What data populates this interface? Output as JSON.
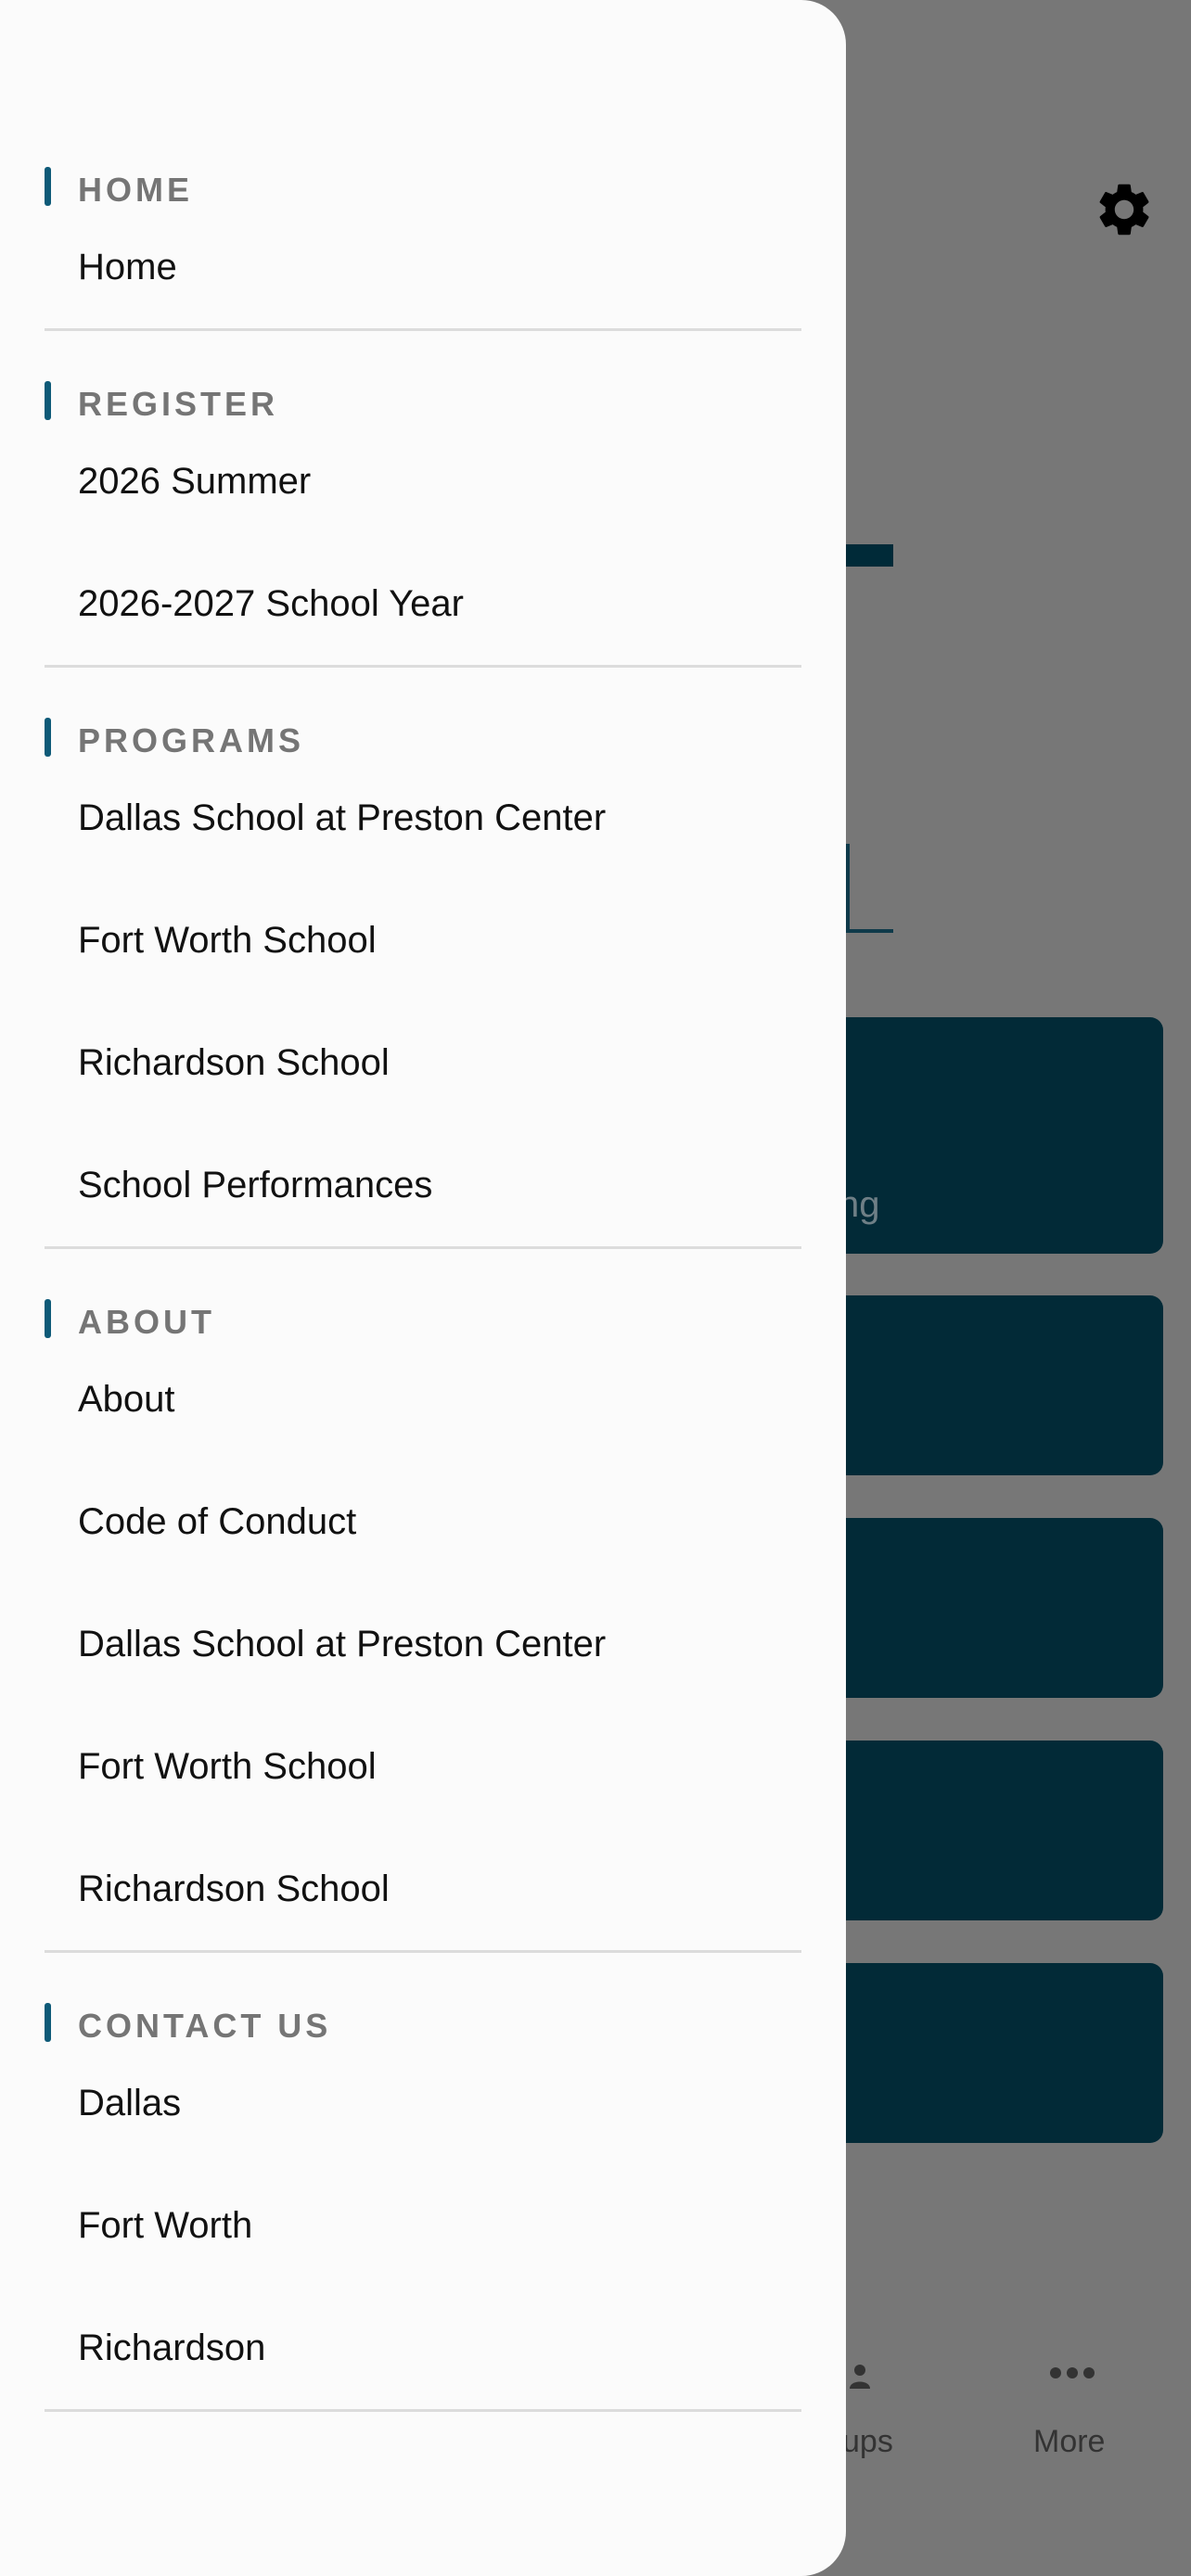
{
  "background": {
    "card_partial_text": "ng",
    "tab_groups_partial": "ups",
    "tab_more": "More",
    "icons": [
      "gear-icon",
      "groups-icon",
      "more-icon"
    ],
    "colors": {
      "overlay": "#777777",
      "card": "#022a37"
    }
  },
  "drawer": {
    "accent_color": "#0e5a78",
    "sections": [
      {
        "title": "HOME",
        "items": [
          "Home"
        ]
      },
      {
        "title": "REGISTER",
        "items": [
          "2026 Summer",
          "2026-2027 School Year"
        ]
      },
      {
        "title": "PROGRAMS",
        "items": [
          "Dallas School at Preston Center",
          "Fort Worth School",
          "Richardson School",
          "School Performances"
        ]
      },
      {
        "title": "ABOUT",
        "items": [
          "About",
          "Code of Conduct",
          "Dallas School at Preston Center",
          "Fort Worth School",
          "Richardson School"
        ]
      },
      {
        "title": "CONTACT US",
        "items": [
          "Dallas",
          "Fort Worth",
          "Richardson"
        ]
      }
    ]
  }
}
